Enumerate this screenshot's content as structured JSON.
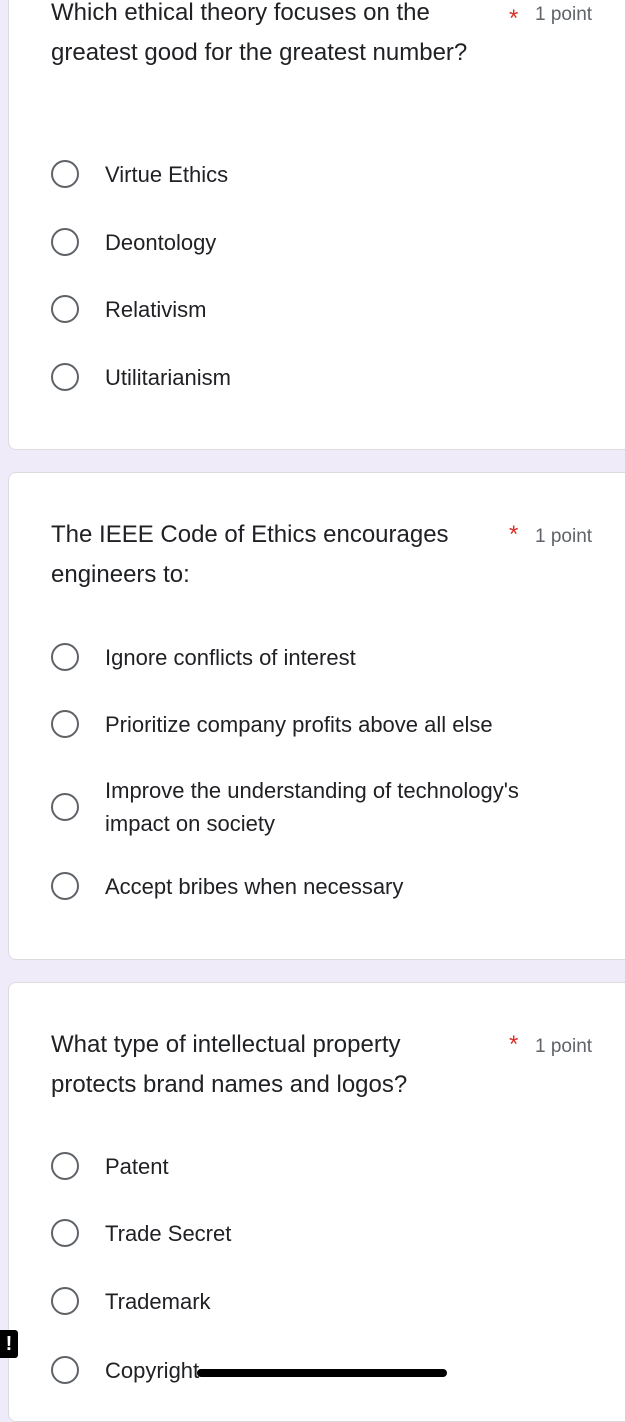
{
  "questions": [
    {
      "text": "Which ethical theory focuses on the greatest good for the greatest number?",
      "required_mark": "*",
      "points": "1 point",
      "options": [
        "Virtue Ethics",
        "Deontology",
        "Relativism",
        "Utilitarianism"
      ]
    },
    {
      "text": "The IEEE Code of Ethics encourages engineers to:",
      "required_mark": "*",
      "points": "1 point",
      "options": [
        "Ignore conflicts of interest",
        "Prioritize company profits above all else",
        "Improve the understanding of technology's impact on society",
        "Accept bribes when necessary"
      ]
    },
    {
      "text": "What type of intellectual property protects brand names and logos?",
      "required_mark": "*",
      "points": "1 point",
      "options": [
        "Patent",
        "Trade Secret",
        "Trademark",
        "Copyright"
      ]
    }
  ],
  "alert_icon_glyph": "!",
  "colors": {
    "background": "#f0ebf8",
    "card": "#ffffff",
    "required": "#d93025",
    "muted": "#5f6368"
  }
}
